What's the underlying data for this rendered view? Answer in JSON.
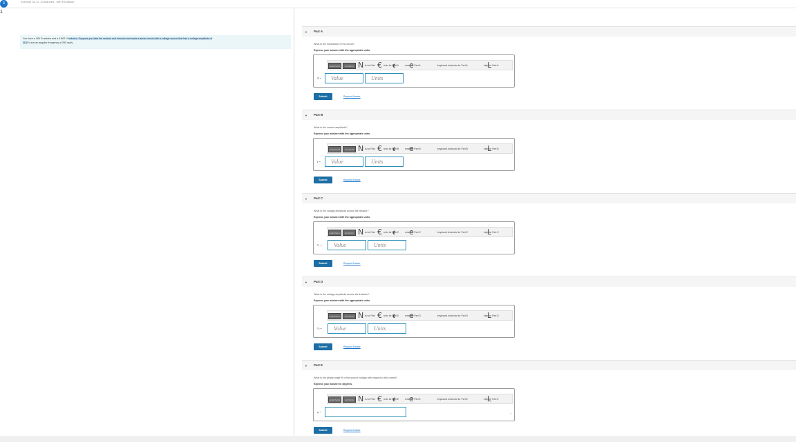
{
  "header": {
    "logo_text": "≡",
    "breadcrumb": "Exercise 31.12 - Enhanced - with Feedback",
    "side_number": "1"
  },
  "problem": {
    "text_before": "You have a 180 Ω resistor and a 0.800 H ",
    "text_highlight": "inductor. Suppose you take the resistor and inductor and make a series circuit with a voltage source that has a voltage amplitude of",
    "text_line2_hl": "30.0",
    "text_after": " V and an angular frequency of 260 rad/s."
  },
  "parts": [
    {
      "title": "Part A",
      "question": "What is the impedance of the circuit?",
      "instruction": "Express your answer with the appropriate units.",
      "variable": "Z =",
      "value_placeholder": "Value",
      "units_placeholder": "Units",
      "toolbar_text1": "ts for Part",
      "toolbar_text2": "redo for Part A",
      "toolbar_text3": "reset for Part A",
      "toolbar_text4": "keyboard shortcuts for Part A",
      "toolbar_text5": "help for Part A",
      "btn1": "undo Part A",
      "btn2": "for Part A",
      "submit": "Submit",
      "request": "Request Answer"
    },
    {
      "title": "Part B",
      "question": "What is the current amplitude?",
      "instruction": "Express your answer with the appropriate units.",
      "variable": "I =",
      "value_placeholder": "Value",
      "units_placeholder": "Units",
      "toolbar_text1": "ts for Part",
      "toolbar_text2": "redo for Part B",
      "toolbar_text3": "reset for Part B",
      "toolbar_text4": "keyboard shortcuts for Part B",
      "toolbar_text5": "help for Part B",
      "btn1": "undo Part B",
      "btn2": "for Part B",
      "submit": "Submit",
      "request": "Request Answer"
    },
    {
      "title": "Part C",
      "question": "What is the voltage amplitude across the resistor?",
      "instruction": "Express your answer with the appropriate units.",
      "variable": "Vᵣ =",
      "value_placeholder": "Value",
      "units_placeholder": "Units",
      "toolbar_text1": "ts for Part",
      "toolbar_text2": "redo for Part C",
      "toolbar_text3": "reset for Part C",
      "toolbar_text4": "keyboard shortcuts for Part C",
      "toolbar_text5": "help for Part C",
      "btn1": "undo Part C",
      "btn2": "for Part C",
      "submit": "Submit",
      "request": "Request Answer"
    },
    {
      "title": "Part D",
      "question": "What is the voltage amplitude across the inductor?",
      "instruction": "Express your answer with the appropriate units.",
      "variable": "Vₗ =",
      "value_placeholder": "Value",
      "units_placeholder": "Units",
      "toolbar_text1": "ts for Part",
      "toolbar_text2": "redo for Part D",
      "toolbar_text3": "reset for Part D",
      "toolbar_text4": "keyboard shortcuts for Part D",
      "toolbar_text5": "help for Part D",
      "btn1": "undo Part D",
      "btn2": "for Part D",
      "submit": "Submit",
      "request": "Request Answer"
    },
    {
      "title": "Part E",
      "question": "What is the phase angle Φ of the source voltage with respect to the current?",
      "instruction": "Express your answer in degrees.",
      "variable": "φ =",
      "value_placeholder": "",
      "units_placeholder": "",
      "toolbar_text1": "ts for Part",
      "toolbar_text2": "redo for Part E",
      "toolbar_text3": "reset for Part E",
      "toolbar_text4": "keyboard shortcuts for Part E",
      "toolbar_text5": "help for Part E",
      "btn1": "undo Part E",
      "btn2": "for Part E",
      "submit": "Submit",
      "request": "Request Answer"
    }
  ]
}
